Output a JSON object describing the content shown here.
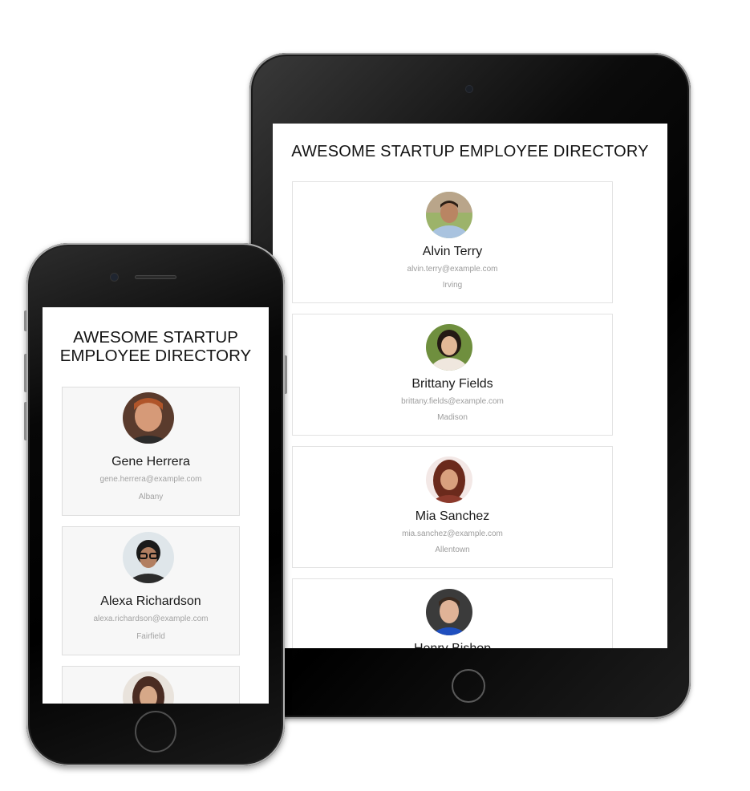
{
  "tablet": {
    "title": "AWESOME STARTUP EMPLOYEE DIRECTORY",
    "employees": [
      {
        "name": "Alvin Terry",
        "email": "alvin.terry@example.com",
        "city": "Irving"
      },
      {
        "name": "Brittany Fields",
        "email": "brittany.fields@example.com",
        "city": "Madison"
      },
      {
        "name": "Mia Sanchez",
        "email": "mia.sanchez@example.com",
        "city": "Allentown"
      },
      {
        "name": "Henry Bishop",
        "email": "",
        "city": ""
      }
    ]
  },
  "phone": {
    "title_line1": "AWESOME STARTUP",
    "title_line2": "EMPLOYEE DIRECTORY",
    "employees": [
      {
        "name": "Gene Herrera",
        "email": "gene.herrera@example.com",
        "city": "Albany"
      },
      {
        "name": "Alexa Richardson",
        "email": "alexa.richardson@example.com",
        "city": "Fairfield"
      },
      {
        "name": "",
        "email": "",
        "city": ""
      }
    ]
  },
  "colors": {
    "text": "#141414",
    "muted": "#9c9c9c",
    "card_border": "#e2e2e2",
    "device_body": "#000000"
  }
}
